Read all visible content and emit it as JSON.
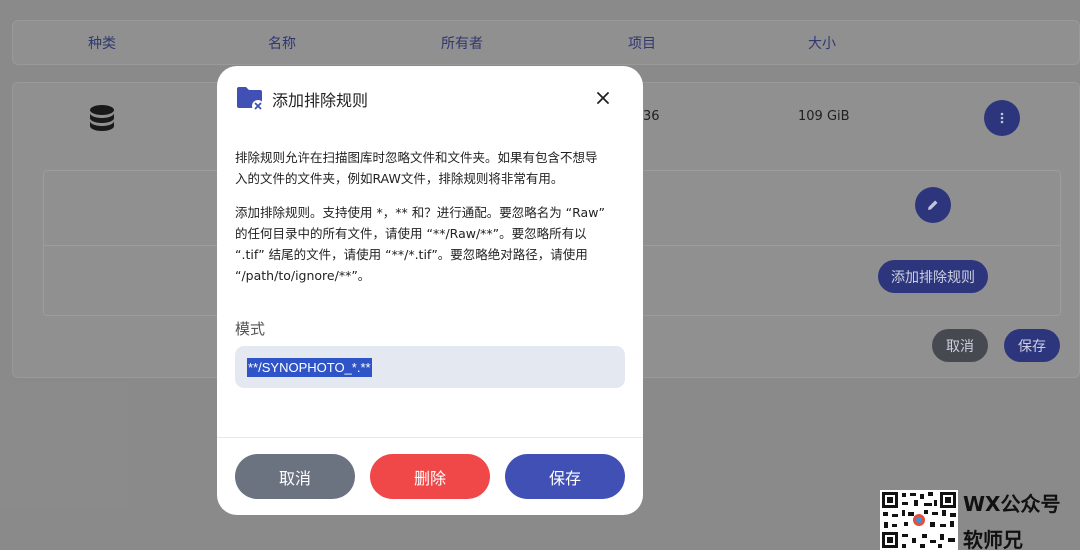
{
  "table": {
    "columns": [
      "种类",
      "名称",
      "所有者",
      "项目",
      "大小"
    ],
    "row": {
      "items_partial": "36",
      "size": "109 GiB"
    },
    "add_rule_label": "添加排除规则",
    "cancel_label": "取消",
    "save_label": "保存"
  },
  "dialog": {
    "title": "添加排除规则",
    "desc1_line1": "排除规则允许在扫描图库时忽略文件和文件夹。如果有包含不想导",
    "desc1_line2": "入的文件的文件夹，例如RAW文件，排除规则将非常有用。",
    "desc2_line1": "添加排除规则。支持使用 *，** 和？进行通配。要忽略名为 “Raw”",
    "desc2_line2": "的任何目录中的所有文件，请使用 “**/Raw/**”。要忽略所有以",
    "desc2_line3": "“.tif” 结尾的文件，请使用 “**/*.tif”。要忽略绝对路径，请使用",
    "desc2_line4": "“/path/to/ignore/**”。",
    "pattern_label": "模式",
    "pattern_value": "**/SYNOPHOTO_*.**",
    "cancel_label": "取消",
    "delete_label": "删除",
    "save_label": "保存"
  },
  "watermark": {
    "line1": "WX公众号",
    "line2": "软师兄"
  },
  "colors": {
    "primary": "#4150b5",
    "danger": "#f04848",
    "neutral": "#6b7280"
  },
  "icons": [
    "database-icon",
    "more-vert-icon",
    "edit-icon",
    "folder-exclude-icon",
    "close-icon"
  ]
}
